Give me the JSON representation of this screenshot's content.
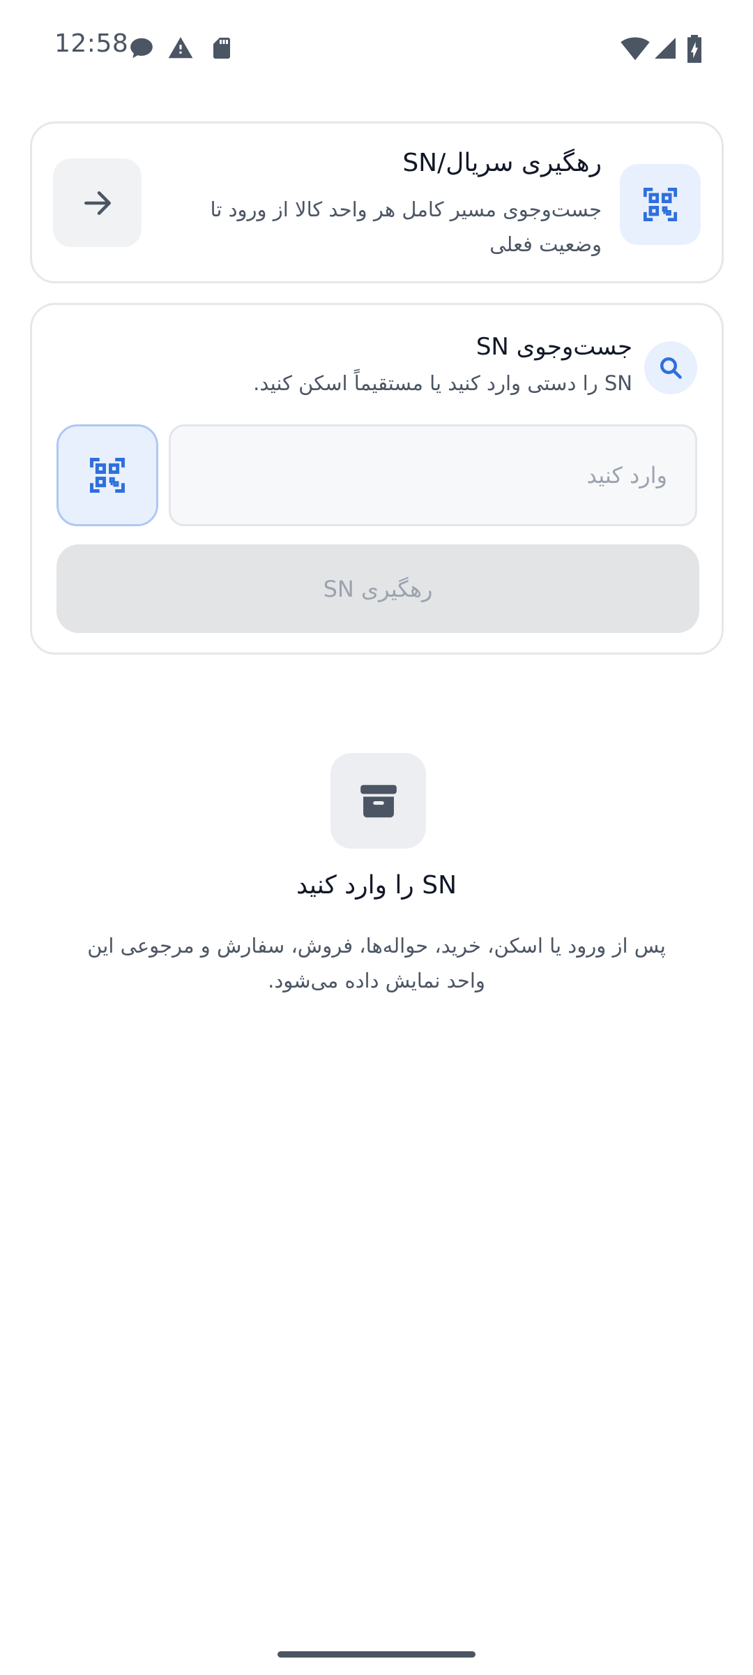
{
  "status_bar": {
    "time": "12:58",
    "left_icons": [
      "chat-bubble-icon",
      "warning-icon",
      "sd-card-icon"
    ],
    "right_icons": [
      "wifi-icon",
      "cell-signal-icon",
      "battery-charging-icon"
    ]
  },
  "track_card": {
    "title": "رهگیری سریال/SN",
    "description": "جست‌وجوی مسیر کامل هر واحد کالا از ورود تا وضعیت فعلی",
    "leading_icon": "qr-scan-icon",
    "action_icon": "arrow-right-icon"
  },
  "search_card": {
    "icon": "search-icon",
    "title": "جست‌وجوی SN",
    "subtitle": "SN را دستی وارد کنید یا مستقیماً اسکن کنید.",
    "input_placeholder": "وارد کنید",
    "input_value": "",
    "scan_icon": "qr-scan-icon",
    "submit_label": "رهگیری SN"
  },
  "empty_state": {
    "icon": "archive-box-icon",
    "title": "SN را وارد کنید",
    "description": "پس از ورود یا اسکن، خرید، حواله‌ها، فروش، سفارش و مرجوعی این واحد نمایش داده می‌شود."
  },
  "colors": {
    "accent": "#2f6fdc",
    "accent_bg": "#e8f0fe",
    "card_border": "#e5e7eb",
    "disabled_bg": "#e3e4e6",
    "muted_text": "#4b5563"
  }
}
